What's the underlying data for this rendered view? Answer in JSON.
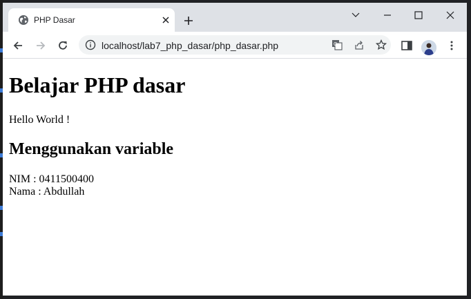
{
  "browser": {
    "tab": {
      "title": "PHP Dasar",
      "favicon": "globe-icon",
      "close_icon": "close-icon"
    },
    "new_tab_icon": "plus-icon",
    "window_controls": [
      "chevron-down-icon",
      "minimize-icon",
      "maximize-icon",
      "close-icon"
    ],
    "toolbar": {
      "nav_icons": [
        "back-arrow-icon",
        "forward-arrow-icon",
        "reload-icon"
      ],
      "url": "localhost/lab7_php_dasar/php_dasar.php",
      "omnibox_icons": [
        "info-icon",
        "translate-icon",
        "share-icon",
        "star-icon"
      ],
      "right_icons": [
        "side-panel-icon",
        "avatar",
        "more-vert-icon"
      ]
    },
    "colors": {
      "tabstrip": "#dee1e6",
      "omnibox": "#f1f3f4",
      "icon": "#5f6368",
      "frame": "#202124"
    }
  },
  "page": {
    "heading": "Belajar PHP dasar",
    "hello": "Hello World !",
    "subheading": "Menggunakan variable",
    "nim_line": "NIM : 0411500400",
    "nama_line": "Nama : Abdullah"
  }
}
